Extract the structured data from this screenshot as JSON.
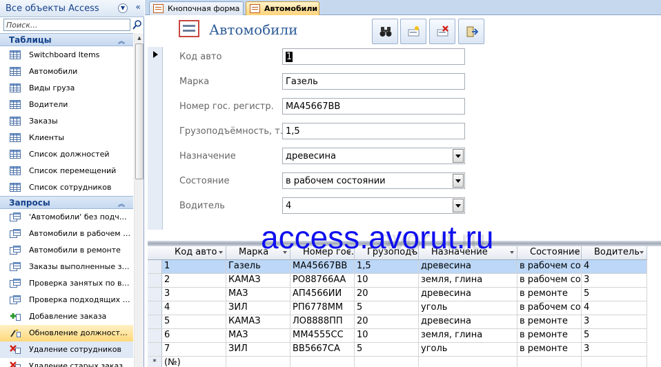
{
  "nav": {
    "title": "Все объекты Access",
    "search_placeholder": "Поиск...",
    "groups": [
      {
        "label": "Таблицы",
        "items": [
          {
            "label": "Switchboard Items",
            "icon": "table-icon"
          },
          {
            "label": "Автомобили",
            "icon": "table-icon"
          },
          {
            "label": "Виды груза",
            "icon": "table-icon"
          },
          {
            "label": "Водители",
            "icon": "table-icon"
          },
          {
            "label": "Заказы",
            "icon": "table-icon"
          },
          {
            "label": "Клиенты",
            "icon": "table-icon"
          },
          {
            "label": "Список должностей",
            "icon": "table-icon"
          },
          {
            "label": "Список перемещений",
            "icon": "table-icon"
          },
          {
            "label": "Список сотрудников",
            "icon": "table-icon"
          }
        ]
      },
      {
        "label": "Запросы",
        "items": [
          {
            "label": "'Автомобили' без подчиненных",
            "icon": "select-query-icon"
          },
          {
            "label": "Автомобили в рабочем состоянии",
            "icon": "select-query-icon"
          },
          {
            "label": "Автомобили в ремонте",
            "icon": "select-query-icon"
          },
          {
            "label": "Заказы выполненные за период",
            "icon": "select-query-icon"
          },
          {
            "label": "Проверка занятых по времени",
            "icon": "select-query-icon"
          },
          {
            "label": "Проверка подходящих автомобилей",
            "icon": "select-query-icon"
          },
          {
            "label": "Добавление заказа",
            "icon": "append-query-icon"
          },
          {
            "label": "Обновление должности сотрудника",
            "icon": "update-query-icon"
          },
          {
            "label": "Удаление сотрудников",
            "icon": "delete-query-icon"
          },
          {
            "label": "Удаление старых заказов",
            "icon": "delete-query-icon"
          }
        ]
      }
    ]
  },
  "tabs": [
    {
      "label": "Кнопочная форма",
      "active": false
    },
    {
      "label": "Автомобили",
      "active": true
    }
  ],
  "form": {
    "title": "Автомобили",
    "toolbar": [
      "find-icon",
      "new-record-icon",
      "delete-record-icon",
      "close-form-icon"
    ],
    "fields": [
      {
        "label": "Код авто",
        "value": "1",
        "type": "text"
      },
      {
        "label": "Марка",
        "value": "Газель",
        "type": "text"
      },
      {
        "label": "Номер гос. регистр.",
        "value": "МА45667ВВ",
        "type": "text"
      },
      {
        "label": "Грузоподъёмность, т.",
        "value": "1,5",
        "type": "text"
      },
      {
        "label": "Назначение",
        "value": "древесина",
        "type": "combo"
      },
      {
        "label": "Состояние",
        "value": "в рабочем состоянии",
        "type": "combo"
      },
      {
        "label": "Водитель",
        "value": "4",
        "type": "combo"
      }
    ]
  },
  "sheet": {
    "columns": [
      "Код авто",
      "Марка",
      "Номер гос.",
      "Грузоподъе",
      "Назначение",
      "Состояние",
      "Водитель"
    ],
    "rows": [
      [
        "1",
        "Газель",
        "МА45667ВВ",
        "1,5",
        "древесина",
        "в рабочем сос",
        "4"
      ],
      [
        "2",
        "КАМАЗ",
        "РО88766АА",
        "10",
        "земля, глина",
        "в рабочем сос",
        "3"
      ],
      [
        "3",
        "МАЗ",
        "АП4566ИИ",
        "20",
        "древесина",
        "в ремонте",
        "5"
      ],
      [
        "4",
        "ЗИЛ",
        "РП6778ММ",
        "5",
        "уголь",
        "в рабочем сос",
        "4"
      ],
      [
        "5",
        "КАМАЗ",
        "ЛО8888ПП",
        "20",
        "древесина",
        "в ремонте",
        "3"
      ],
      [
        "6",
        "МАЗ",
        "ММ4555СС",
        "10",
        "земля, глина",
        "в ремонте",
        "5"
      ],
      [
        "7",
        "ЗИЛ",
        "ВВ5667СА",
        "5",
        "уголь",
        "в ремонте",
        "3"
      ]
    ],
    "new_row_marker": "*",
    "new_row_label": "(№)"
  },
  "watermark": "access.avorut.ru",
  "watermark_ghost": "avorut.ru"
}
